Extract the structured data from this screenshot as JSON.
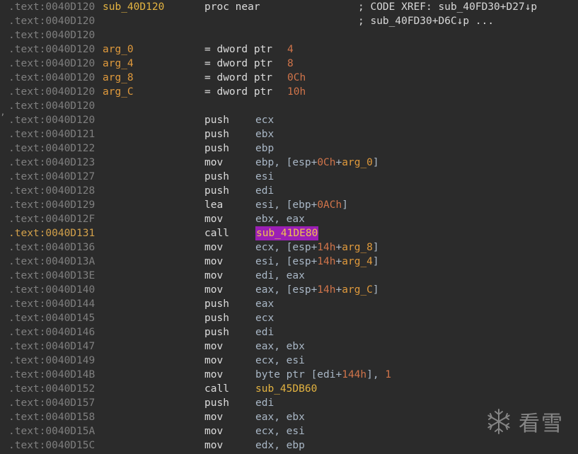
{
  "lines": [
    {
      "addr": ".text:0040D120",
      "label": "sub_40D120",
      "mnem": "proc near",
      "comment": "; CODE XREF: sub_40FD30+D27↓p"
    },
    {
      "addr": ".text:0040D120",
      "comment": "; sub_40FD30+D6C↓p ..."
    },
    {
      "addr": ".text:0040D120"
    },
    {
      "addr": ".text:0040D120",
      "label": "arg_0",
      "eqsign": "= dword ptr",
      "num": "4"
    },
    {
      "addr": ".text:0040D120",
      "label": "arg_4",
      "eqsign": "= dword ptr",
      "num": "8"
    },
    {
      "addr": ".text:0040D120",
      "label": "arg_8",
      "eqsign": "= dword ptr",
      "num": "0Ch"
    },
    {
      "addr": ".text:0040D120",
      "label": "arg_C",
      "eqsign": "= dword ptr",
      "num": "10h"
    },
    {
      "addr": ".text:0040D120"
    },
    {
      "addr": ".text:0040D120",
      "mnem": "push",
      "ops": "ecx"
    },
    {
      "addr": ".text:0040D121",
      "mnem": "push",
      "ops": "ebx"
    },
    {
      "addr": ".text:0040D122",
      "mnem": "push",
      "ops": "ebp"
    },
    {
      "addr": ".text:0040D123",
      "mnem": "mov",
      "ops_parts": [
        {
          "t": "ebp, [esp+"
        },
        {
          "t": "0Ch",
          "c": "num"
        },
        {
          "t": "+"
        },
        {
          "t": "arg_0",
          "c": "var"
        },
        {
          "t": "]"
        }
      ]
    },
    {
      "addr": ".text:0040D127",
      "mnem": "push",
      "ops": "esi"
    },
    {
      "addr": ".text:0040D128",
      "mnem": "push",
      "ops": "edi"
    },
    {
      "addr": ".text:0040D129",
      "mnem": "lea",
      "ops_parts": [
        {
          "t": "esi, [ebp+"
        },
        {
          "t": "0ACh",
          "c": "num"
        },
        {
          "t": "]"
        }
      ]
    },
    {
      "addr": ".text:0040D12F",
      "mnem": "mov",
      "ops": "ebx, eax"
    },
    {
      "addr": ".text:0040D131",
      "mnem": "call",
      "call_target": "sub_41DE80",
      "active": true
    },
    {
      "addr": ".text:0040D136",
      "mnem": "mov",
      "ops_parts": [
        {
          "t": "ecx, [esp+"
        },
        {
          "t": "14h",
          "c": "num"
        },
        {
          "t": "+"
        },
        {
          "t": "arg_8",
          "c": "var"
        },
        {
          "t": "]"
        }
      ]
    },
    {
      "addr": ".text:0040D13A",
      "mnem": "mov",
      "ops_parts": [
        {
          "t": "esi, [esp+"
        },
        {
          "t": "14h",
          "c": "num"
        },
        {
          "t": "+"
        },
        {
          "t": "arg_4",
          "c": "var"
        },
        {
          "t": "]"
        }
      ]
    },
    {
      "addr": ".text:0040D13E",
      "mnem": "mov",
      "ops": "edi, eax"
    },
    {
      "addr": ".text:0040D140",
      "mnem": "mov",
      "ops_parts": [
        {
          "t": "eax, [esp+"
        },
        {
          "t": "14h",
          "c": "num"
        },
        {
          "t": "+"
        },
        {
          "t": "arg_C",
          "c": "var"
        },
        {
          "t": "]"
        }
      ]
    },
    {
      "addr": ".text:0040D144",
      "mnem": "push",
      "ops": "eax"
    },
    {
      "addr": ".text:0040D145",
      "mnem": "push",
      "ops": "ecx"
    },
    {
      "addr": ".text:0040D146",
      "mnem": "push",
      "ops": "edi"
    },
    {
      "addr": ".text:0040D147",
      "mnem": "mov",
      "ops": "eax, ebx"
    },
    {
      "addr": ".text:0040D149",
      "mnem": "mov",
      "ops": "ecx, esi"
    },
    {
      "addr": ".text:0040D14B",
      "mnem": "mov",
      "ops_parts": [
        {
          "t": "byte ptr [edi+"
        },
        {
          "t": "144h",
          "c": "num"
        },
        {
          "t": "], "
        },
        {
          "t": "1",
          "c": "num"
        }
      ]
    },
    {
      "addr": ".text:0040D152",
      "mnem": "call",
      "call_target": "sub_45DB60"
    },
    {
      "addr": ".text:0040D157",
      "mnem": "push",
      "ops": "edi"
    },
    {
      "addr": ".text:0040D158",
      "mnem": "mov",
      "ops": "eax, ebx"
    },
    {
      "addr": ".text:0040D15A",
      "mnem": "mov",
      "ops": "ecx, esi"
    },
    {
      "addr": ".text:0040D15C",
      "mnem": "mov",
      "ops": "edx, ebp"
    }
  ],
  "watermark": {
    "text": "看雪",
    "icon": "snowflake-icon"
  },
  "colors": {
    "background": "#2b2b2b",
    "address": "#7f7f7f",
    "address_active": "#d2a04a",
    "label": "#e3b341",
    "variable": "#e09a3c",
    "number": "#d0744a",
    "highlight_bg": "#9b1fb5"
  }
}
